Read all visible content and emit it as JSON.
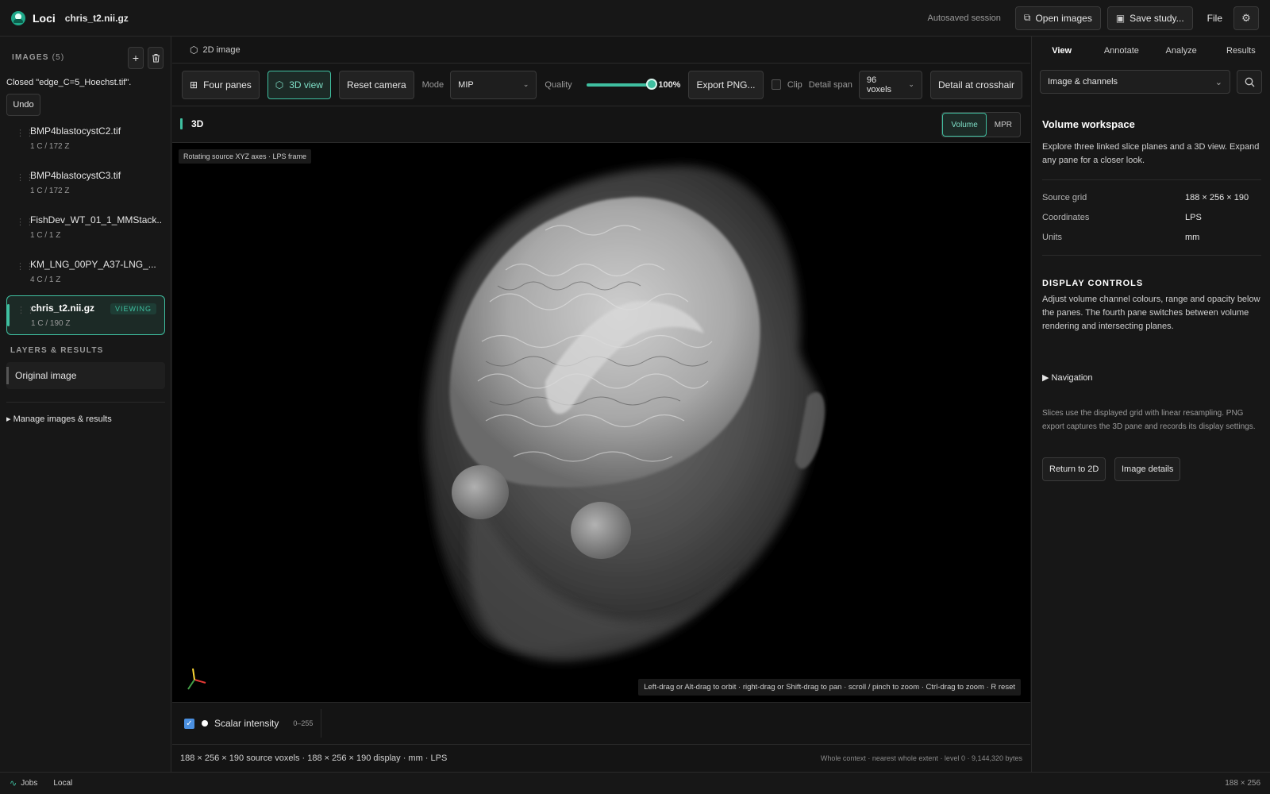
{
  "header": {
    "app_name": "Loci",
    "file_name": "chris_t2.nii.gz",
    "autosave": "Autosaved session",
    "open_images": "Open images",
    "save_study": "Save study...",
    "file_menu": "File"
  },
  "sidebar": {
    "images_heading": "IMAGES",
    "images_count": "(5)",
    "closed_message": "Closed \"edge_C=5_Hoechst.tif\".",
    "undo": "Undo",
    "images": [
      {
        "name": "BMP4blastocystC2.tif",
        "meta": "1 C / 172 Z"
      },
      {
        "name": "BMP4blastocystC3.tif",
        "meta": "1 C / 172 Z"
      },
      {
        "name": "FishDev_WT_01_1_MMStack...",
        "meta": "1 C / 1 Z"
      },
      {
        "name": "KM_LNG_00PY_A37-LNG_...",
        "meta": "4 C / 1 Z"
      },
      {
        "name": "chris_t2.nii.gz",
        "meta": "1 C / 190 Z",
        "badge": "VIEWING"
      }
    ],
    "layers_heading": "LAYERS & RESULTS",
    "layer": "Original image",
    "manage": "Manage images & results"
  },
  "center": {
    "crumb": "2D image",
    "toolbar": {
      "four_panes": "Four panes",
      "view_3d": "3D view",
      "reset_camera": "Reset camera",
      "mode_label": "Mode",
      "mode_value": "MIP",
      "quality_label": "Quality",
      "quality_value": "100%",
      "quality_fraction": 1.0,
      "export_png": "Export PNG...",
      "clip_label": "Clip",
      "detail_span_label": "Detail span",
      "detail_span_value": "96 voxels",
      "detail_crosshair": "Detail at crosshair"
    },
    "pane": {
      "title": "3D",
      "volume": "Volume",
      "mpr": "MPR"
    },
    "viewport": {
      "tag": "Rotating source XYZ axes · LPS frame",
      "hint": "Left-drag or Alt-drag to orbit · right-drag or Shift-drag to pan · scroll / pinch to zoom · Ctrl-drag to zoom · R reset"
    },
    "channel": {
      "check": "✓",
      "name": "Scalar intensity",
      "range": "0–255"
    },
    "status_left": "188 × 256 × 190 source voxels · 188 × 256 × 190 display · mm · LPS",
    "status_right": "Whole context · nearest whole extent · level 0 · 9,144,320 bytes"
  },
  "right": {
    "tabs": [
      "View",
      "Annotate",
      "Analyze",
      "Results"
    ],
    "select": "Image & channels",
    "title": "Volume workspace",
    "desc": "Explore three linked slice planes and a 3D view. Expand any pane for a closer look.",
    "kv": [
      {
        "k": "Source grid",
        "v": "188 × 256 × 190"
      },
      {
        "k": "Coordinates",
        "v": "LPS"
      },
      {
        "k": "Units",
        "v": "mm"
      }
    ],
    "display_heading": "DISPLAY CONTROLS",
    "display_desc": "Adjust volume channel colours, range and opacity below the panes. The fourth pane switches between volume rendering and intersecting planes.",
    "navigation": "▶ Navigation",
    "note": "Slices use the displayed grid with linear resampling. PNG export captures the 3D pane and records its display settings.",
    "return_2d": "Return to 2D",
    "image_details": "Image details"
  },
  "footer": {
    "jobs": "Jobs",
    "local": "Local",
    "dims": "188 × 256"
  },
  "colors": {
    "accent": "#3fbfa0",
    "background": "#141414",
    "panel": "#171717"
  }
}
